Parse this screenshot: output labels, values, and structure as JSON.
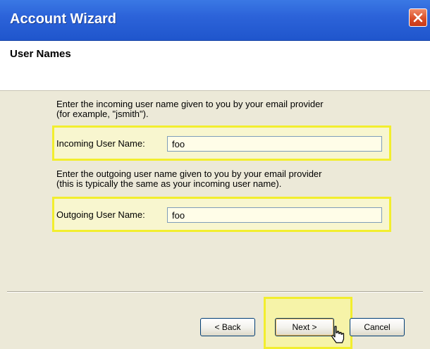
{
  "window": {
    "title": "Account Wizard"
  },
  "header": {
    "title": "User Names"
  },
  "incoming": {
    "instruction": "Enter the incoming user name given to you by your email provider\n(for example, \"jsmith\").",
    "label": "Incoming User Name:",
    "value": "foo"
  },
  "outgoing": {
    "instruction": "Enter the outgoing user name given to you by your email provider\n(this is typically the same as your incoming user name).",
    "label": "Outgoing User Name:",
    "value": "foo"
  },
  "buttons": {
    "back": "< Back",
    "next": "Next >",
    "cancel": "Cancel"
  },
  "icons": {
    "close": "close-icon",
    "cursor": "mouse-pointer-icon"
  },
  "colors": {
    "titlebar": "#2c63d9",
    "highlight": "#f2ee2e",
    "close_button": "#d84b25"
  }
}
